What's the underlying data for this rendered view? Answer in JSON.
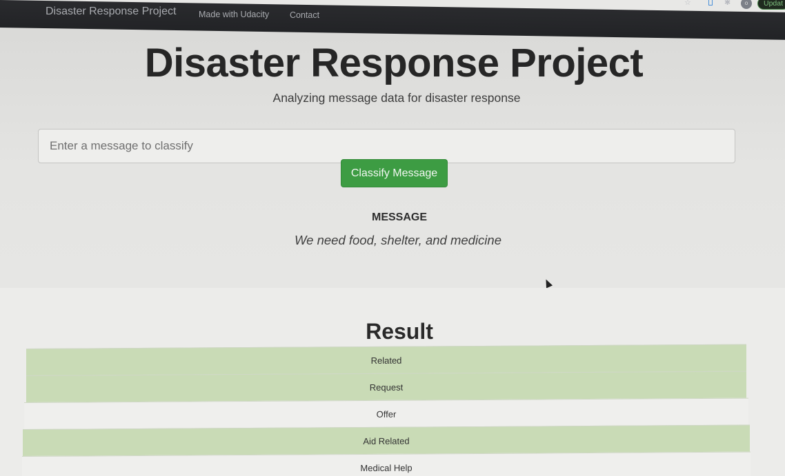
{
  "navbar": {
    "brand": "Disaster Response Project",
    "links": [
      "Made with Udacity",
      "Contact"
    ],
    "update_label": "Updat",
    "profile_initial": "o"
  },
  "jumbotron": {
    "title": "Disaster Response Project",
    "subtitle": "Analyzing message data for disaster response",
    "input_placeholder": "Enter a message to classify",
    "input_value": "",
    "button_label": "Classify Message",
    "message_heading": "MESSAGE",
    "message_text": "We need food, shelter, and medicine"
  },
  "result": {
    "title": "Result",
    "rows": [
      {
        "label": "Related",
        "positive": true
      },
      {
        "label": "Request",
        "positive": true
      },
      {
        "label": "Offer",
        "positive": false
      },
      {
        "label": "Aid Related",
        "positive": true
      },
      {
        "label": "Medical Help",
        "positive": false
      }
    ]
  },
  "colors": {
    "positive_row": "#c9dbb6",
    "negative_row": "#efefed",
    "button_green": "#3d9c43",
    "navbar": "#242528"
  },
  "icons": [
    "star-icon",
    "extension-icon",
    "puzzle-icon",
    "profile-icon",
    "cursor-icon"
  ]
}
